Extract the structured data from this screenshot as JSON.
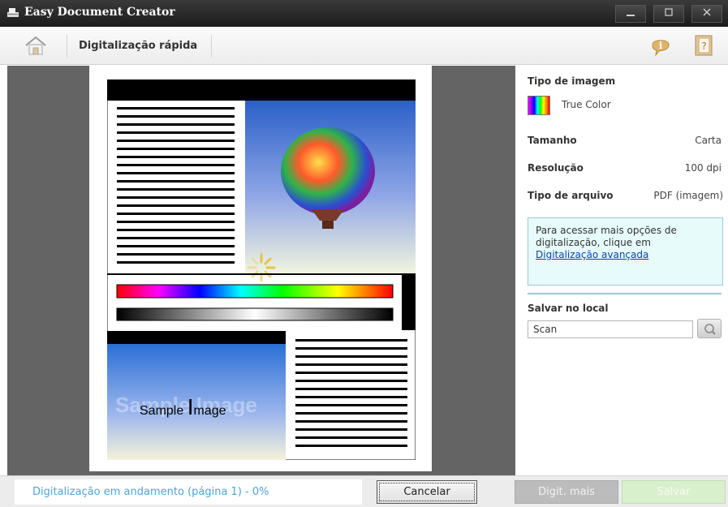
{
  "window": {
    "title": "Easy Document Creator"
  },
  "toolbar": {
    "title": "Digitalização rápida",
    "info_glyph": "i",
    "help_glyph": "?"
  },
  "preview": {
    "sample_caption_i": "I",
    "sample_caption_before": "Sample ",
    "sample_caption_after": "mage",
    "sample_watermark": "Sample Image"
  },
  "settings": {
    "image_type_label": "Tipo de imagem",
    "image_type_value": "True Color",
    "size_label": "Tamanho",
    "size_value": "Carta",
    "resolution_label": "Resolução",
    "resolution_value": "100 dpi",
    "file_type_label": "Tipo de arquivo",
    "file_type_value": "PDF (imagem)",
    "info_text": "Para acessar mais opções de digitalização, clique em",
    "info_link": "Digitalização avançada",
    "save_location_label": "Salvar no local",
    "save_location_value": "Scan"
  },
  "footer": {
    "status": "Digitalização em andamento (página 1) - 0%",
    "progress_percent": 0,
    "cancel_label": "Cancelar",
    "more_label": "Digit. mais",
    "save_label": "Salvar"
  },
  "icons": {
    "app": "scanner-icon",
    "home": "home-icon",
    "info": "info-icon",
    "help": "help-icon",
    "search": "search-icon",
    "spinner": "loading-spinner-icon"
  },
  "colors": {
    "status_text": "#4fa3d8",
    "info_box_bg": "#e7fbfb",
    "save_button_bg": "#d9f0cd",
    "more_button_bg": "#bcbcbc"
  }
}
